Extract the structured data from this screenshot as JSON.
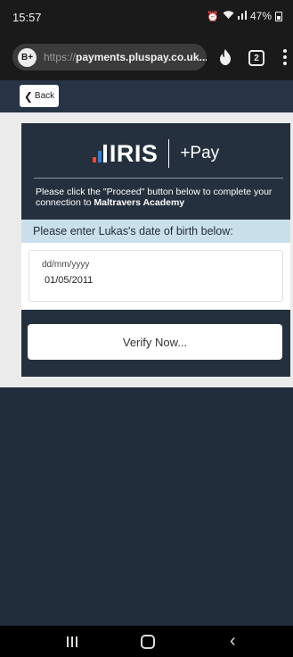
{
  "status_bar": {
    "time": "15:57",
    "alarm_icon": "alarm-icon",
    "wifi_icon": "wifi-icon",
    "signal_icon": "signal-icon",
    "battery": "47%"
  },
  "browser": {
    "badge": "B+",
    "url_scheme": "https://",
    "url_host": "payments.pluspay.co.uk...",
    "flame_icon": "flame-icon",
    "tab_count": "2",
    "menu_icon": "more-vert-icon"
  },
  "header": {
    "back_label": "Back"
  },
  "card": {
    "logo_text": "IRIS",
    "logo_sub": "+Pay",
    "intro_text": "Please click the \"Proceed\" button below to complete your connection to ",
    "school_name": "Maltravers Academy",
    "prompt": "Please enter Lukas's date of birth below:",
    "dob_placeholder": "dd/mm/yyyy",
    "dob_value": "01/05/2011",
    "verify_label": "Verify Now..."
  },
  "colors": {
    "page_bg": "#222d3b",
    "card_bg": "#25303e",
    "prompt_bg": "#c9e0ea",
    "logo_red": "#e84a3a",
    "logo_blue": "#2f7fd3"
  }
}
